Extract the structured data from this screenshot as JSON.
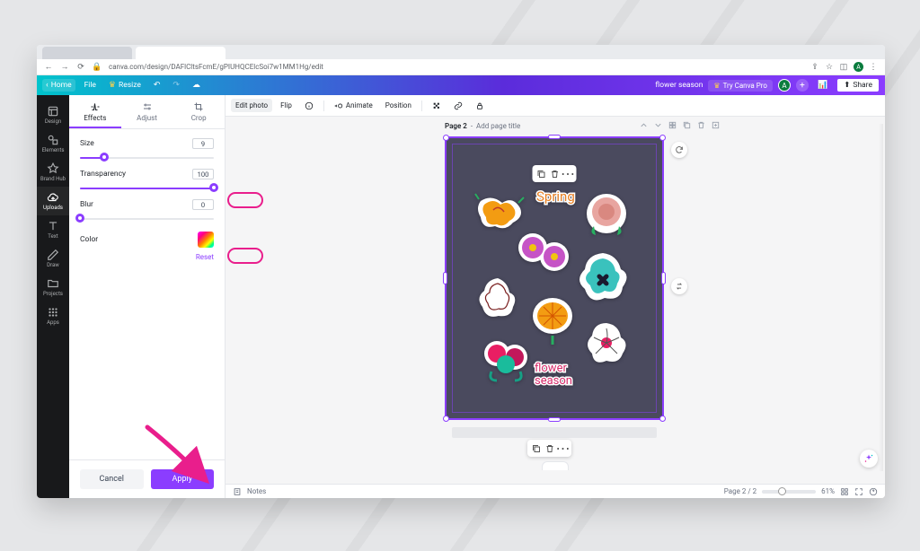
{
  "browser": {
    "url": "canva.com/design/DAFlCltsFcmE/gPIUHQCElcSoi7w1MM1Hg/edit",
    "avatar_letter": "A"
  },
  "topbar": {
    "home": "Home",
    "file": "File",
    "resize": "Resize",
    "title": "flower season",
    "pro": "Try Canva Pro",
    "share": "Share",
    "avatar_letter": "A"
  },
  "rail": [
    {
      "l": "Design"
    },
    {
      "l": "Elements"
    },
    {
      "l": "Brand Hub"
    },
    {
      "l": "Uploads"
    },
    {
      "l": "Text"
    },
    {
      "l": "Draw"
    },
    {
      "l": "Projects"
    },
    {
      "l": "Apps"
    }
  ],
  "panel": {
    "tabs": {
      "effects": "Effects",
      "adjust": "Adjust",
      "crop": "Crop"
    },
    "size": {
      "label": "Size",
      "value": "9",
      "pct": 18
    },
    "transparency": {
      "label": "Transparency",
      "value": "100",
      "pct": 100
    },
    "blur": {
      "label": "Blur",
      "value": "0",
      "pct": 0
    },
    "color": "Color",
    "reset": "Reset",
    "cancel": "Cancel",
    "apply": "Apply"
  },
  "toolbar": {
    "edit": "Edit photo",
    "flip": "Flip",
    "animate": "Animate",
    "position": "Position"
  },
  "page": {
    "label": "Page 2",
    "hint": "Add page title",
    "counter": "Page 2 / 2",
    "zoom": "61%",
    "notes": "Notes"
  },
  "art": {
    "spring": "Spring",
    "flower_season": "flower\nseason"
  }
}
